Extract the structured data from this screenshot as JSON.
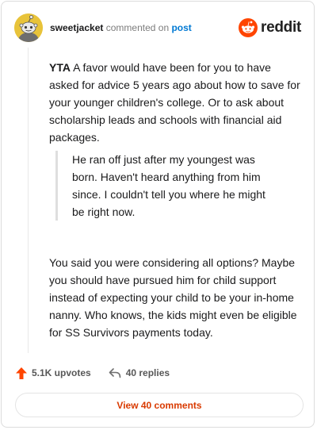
{
  "header": {
    "username": "sweetjacket",
    "action_text": "commented on",
    "link_text": "post",
    "brand_name": "reddit",
    "avatar_icon": "snoo-avatar-icon",
    "brand_icon": "reddit-snoo-icon",
    "brand_color": "#ff4500",
    "avatar_color": "#e8c33a"
  },
  "comment": {
    "lead_bold": "YTA",
    "lead_text": " A favor would have been for you to have asked for advice 5 years ago about how to save for your younger children's college. Or to ask about scholarship leads and schools with financial aid packages.",
    "quote": "He ran off just after my youngest was born. Haven't heard anything from him since. I couldn't tell you where he might be right now.",
    "paragraph2": "You said you were considering all options? Maybe you should have pursued him for child support instead of expecting your child to be your in-home nanny. Who knows, the kids might even be eligible for SS Survivors payments today."
  },
  "footer": {
    "upvotes_label": "5.1K upvotes",
    "replies_label": "40 replies",
    "upvote_icon": "upvote-arrow-icon",
    "reply_icon": "reply-arrow-icon",
    "upvote_color": "#ff4500",
    "view_comments_label": "View 40 comments",
    "view_comments_color": "#d93a00"
  }
}
